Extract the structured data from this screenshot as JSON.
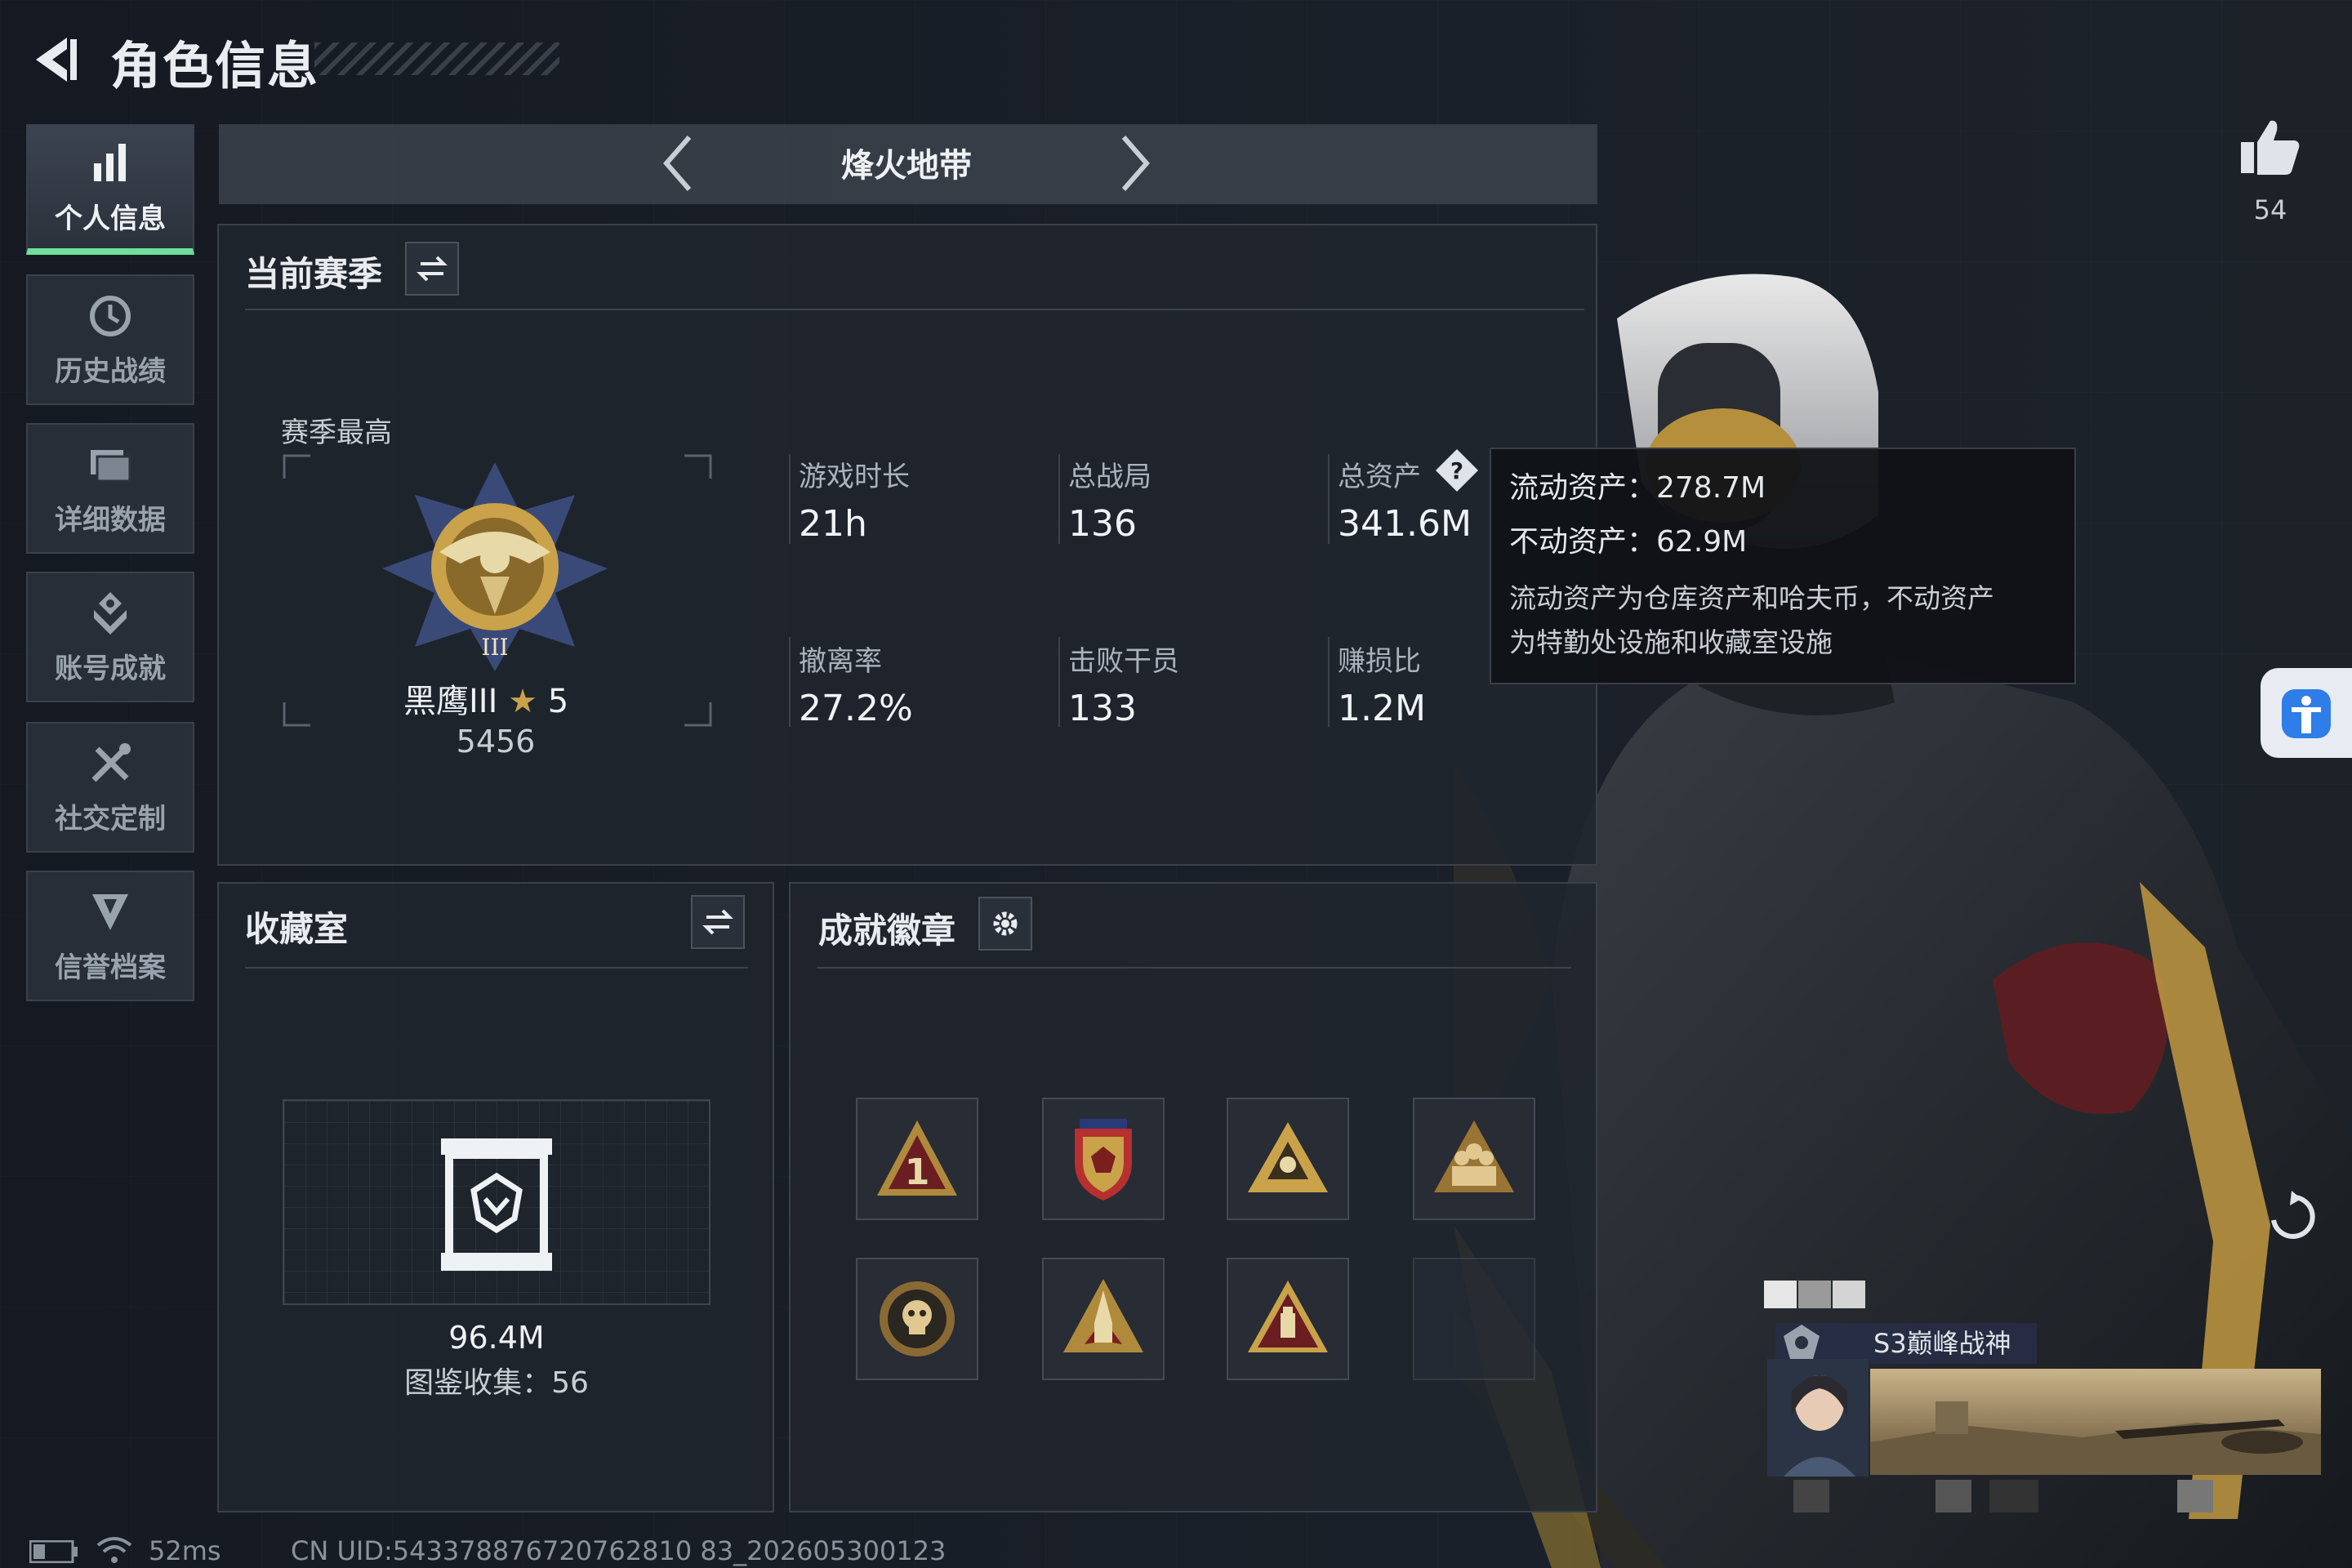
{
  "header": {
    "title": "角色信息"
  },
  "sidebar": {
    "items": [
      {
        "label": "个人信息",
        "icon": "bar-chart-icon",
        "active": true
      },
      {
        "label": "历史战绩",
        "icon": "history-icon"
      },
      {
        "label": "详细数据",
        "icon": "folder-icon"
      },
      {
        "label": "账号成就",
        "icon": "achievement-icon"
      },
      {
        "label": "社交定制",
        "icon": "tools-icon"
      },
      {
        "label": "信誉档案",
        "icon": "shield-icon"
      }
    ]
  },
  "mode": {
    "title": "烽火地带"
  },
  "season": {
    "title": "当前赛季",
    "best_label": "赛季最高",
    "rank_name": "黑鹰III",
    "rank_stars": "5",
    "rank_score": "5456",
    "stats": [
      {
        "label": "游戏时长",
        "value": "21h"
      },
      {
        "label": "总战局",
        "value": "136"
      },
      {
        "label": "总资产",
        "value": "341.6M"
      },
      {
        "label": "撤离率",
        "value": "27.2%"
      },
      {
        "label": "击败干员",
        "value": "133"
      },
      {
        "label": "赚损比",
        "value": "1.2M"
      }
    ]
  },
  "tooltip": {
    "liquid": "流动资产：278.7M",
    "fixed": "不动资产：62.9M",
    "desc_1": "流动资产为仓库资产和哈夫币，不动资产",
    "desc_2": "为特勤处设施和收藏室设施"
  },
  "collection": {
    "title": "收藏室",
    "value": "96.4M",
    "catalog": "图鉴收集：56"
  },
  "badges": {
    "title": "成就徽章"
  },
  "profile": {
    "likes": "54",
    "title_tag": "S3巅峰战神"
  },
  "footer": {
    "ping": "52ms",
    "uid": "CN UID:543378876720762810 83_202605300123"
  },
  "colors": {
    "accent": "#6ddf9a",
    "gold": "#c9a24a",
    "panel": "#20252e"
  }
}
